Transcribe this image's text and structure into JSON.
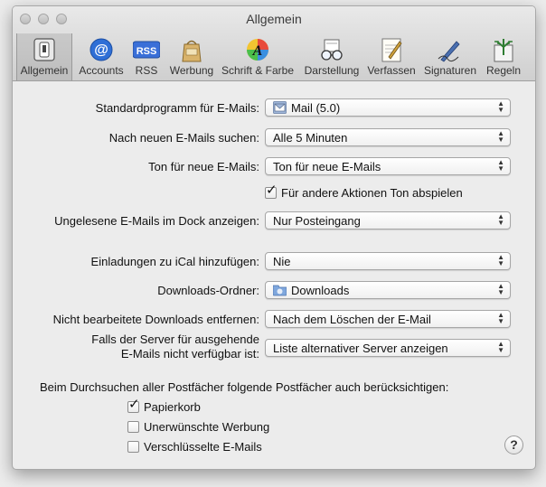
{
  "window": {
    "title": "Allgemein"
  },
  "toolbar": {
    "items": [
      {
        "label": "Allgemein",
        "icon": "switch-icon",
        "selected": true
      },
      {
        "label": "Accounts",
        "icon": "at-sign-icon"
      },
      {
        "label": "RSS",
        "icon": "rss-icon"
      },
      {
        "label": "Werbung",
        "icon": "junk-bag-icon"
      },
      {
        "label": "Schrift & Farbe",
        "icon": "font-color-wheel-icon"
      },
      {
        "label": "Darstellung",
        "icon": "glasses-icon"
      },
      {
        "label": "Verfassen",
        "icon": "pen-paper-icon"
      },
      {
        "label": "Signaturen",
        "icon": "signature-pen-icon"
      },
      {
        "label": "Regeln",
        "icon": "rules-icon"
      }
    ],
    "rss_badge": "RSS"
  },
  "settings": {
    "default_mail": {
      "label": "Standardprogramm für E-Mails:",
      "value": "Mail (5.0)"
    },
    "check_new": {
      "label": "Nach neuen E-Mails suchen:",
      "value": "Alle 5 Minuten"
    },
    "sound_new": {
      "label": "Ton für neue E-Mails:",
      "value": "Ton für neue E-Mails"
    },
    "other_sounds": {
      "label": "Für andere Aktionen Ton abspielen",
      "checked": true
    },
    "dock_unread": {
      "label": "Ungelesene E-Mails im Dock anzeigen:",
      "value": "Nur Posteingang"
    },
    "ical_invites": {
      "label": "Einladungen zu iCal hinzufügen:",
      "value": "Nie"
    },
    "downloads_folder": {
      "label": "Downloads-Ordner:",
      "value": "Downloads"
    },
    "remove_downloads": {
      "label": "Nicht bearbeitete Downloads entfernen:",
      "value": "Nach dem Löschen der E-Mail"
    },
    "server_unavailable": {
      "label_line1": "Falls der Server für ausgehende",
      "label_line2": "E-Mails nicht verfügbar ist:",
      "value": "Liste alternativer Server anzeigen"
    },
    "search_heading": "Beim Durchsuchen aller Postfächer folgende Postfächer auch berücksichtigen:",
    "search_trash": {
      "label": "Papierkorb",
      "checked": true
    },
    "search_junk": {
      "label": "Unerwünschte Werbung",
      "checked": false
    },
    "search_encrypted": {
      "label": "Verschlüsselte E-Mails",
      "checked": false
    },
    "help": "?"
  },
  "colors": {
    "accent": "#3a6fd8",
    "window_bg": "#ececec"
  }
}
